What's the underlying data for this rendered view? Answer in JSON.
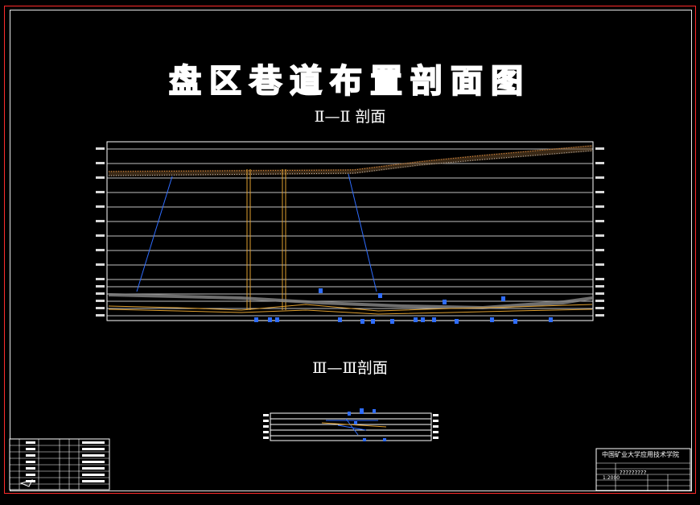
{
  "drawing": {
    "main_title": "盘区巷道布置剖面图",
    "section_1_title": "Ⅱ—Ⅱ 剖面",
    "section_2_title": "Ⅲ—Ⅲ剖面"
  },
  "title_block": {
    "institution": "中国矿业大学应用技术学院",
    "row_a": "?????????",
    "row_b": "1:2000"
  },
  "colors": {
    "border_red": "#ff2a2a",
    "grid_white": "#ffffff",
    "roadway_blue": "#2f6dff",
    "seam_orange": "#e0a030",
    "strata_gray": "#9a9a9a"
  }
}
